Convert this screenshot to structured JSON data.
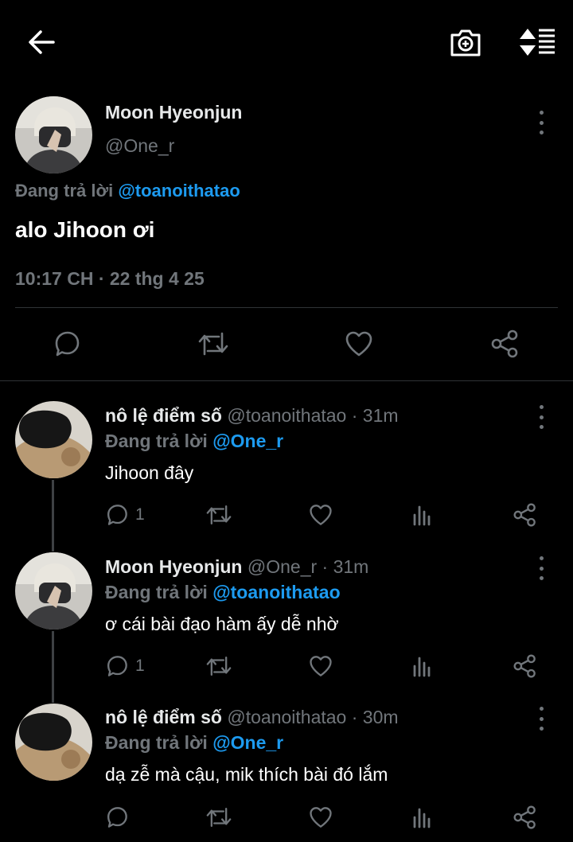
{
  "topbar": {
    "back_icon": "arrow-left-icon",
    "camera_icon": "camera-plus-icon",
    "sort_icon": "sort-lines-icon"
  },
  "main_tweet": {
    "author_name": "Moon Hyeonjun",
    "author_handle": "@One_r",
    "replying_prefix": "Đang trả lời",
    "replying_to": "@toanoithatao",
    "text": "alo Jihoon ơi",
    "timestamp": "10:17 CH · 22 thg 4 25"
  },
  "main_actions": [
    "reply-icon",
    "retweet-icon",
    "like-icon",
    "share-icon"
  ],
  "replies": [
    {
      "name": "nô lệ điểm số",
      "handle": "@toanoithatao",
      "time": "· 31m",
      "replying_prefix": "Đang trả lời",
      "replying_to": "@One_r",
      "text": "Jihoon đây",
      "reply_count": "1",
      "avatar": "bear-plush"
    },
    {
      "name": "Moon Hyeonjun",
      "handle": "@One_r",
      "time": "· 31m",
      "replying_prefix": "Đang trả lời",
      "replying_to": "@toanoithatao",
      "text": "ơ cái bài đạo hàm ấy dễ nhờ",
      "reply_count": "1",
      "avatar": "masked-person"
    },
    {
      "name": "nô lệ điểm số",
      "handle": "@toanoithatao",
      "time": "· 30m",
      "replying_prefix": "Đang trả lời",
      "replying_to": "@One_r",
      "text": "dạ zễ mà cậu, mik thích bài đó lắm",
      "reply_count": "",
      "avatar": "bear-plush"
    }
  ],
  "colors": {
    "background": "#000000",
    "text": "#e7e9ea",
    "muted": "#71767b",
    "accent": "#1d9bf0",
    "divider": "#2f3336"
  }
}
